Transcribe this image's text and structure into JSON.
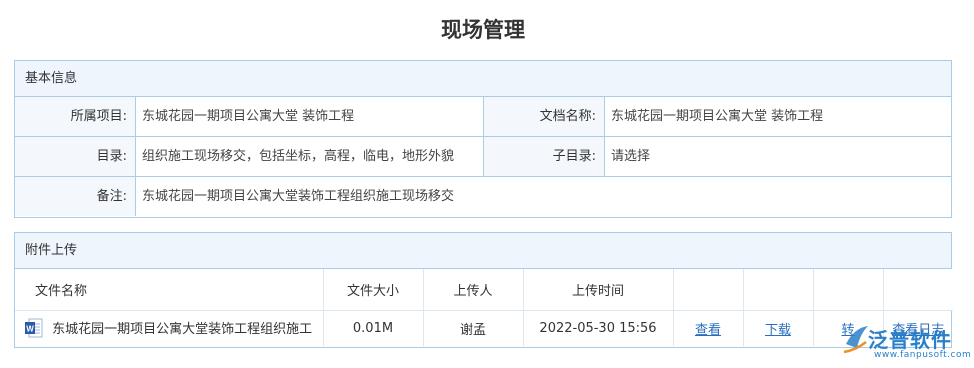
{
  "page": {
    "title": "现场管理"
  },
  "basic_info": {
    "header": "基本信息",
    "project_label": "所属项目:",
    "project_value": "东城花园一期项目公寓大堂 装饰工程",
    "doc_name_label": "文档名称:",
    "doc_name_value": "东城花园一期项目公寓大堂 装饰工程",
    "catalog_label": "目录:",
    "catalog_value": "组织施工现场移交，包括坐标，高程，临电，地形外貌",
    "subcatalog_label": "子目录:",
    "subcatalog_value": "请选择",
    "remark_label": "备注:",
    "remark_value": "东城花园一期项目公寓大堂装饰工程组织施工现场移交"
  },
  "attachments": {
    "header": "附件上传",
    "columns": [
      "文件名称",
      "文件大小",
      "上传人",
      "上传时间",
      "",
      "",
      "",
      ""
    ],
    "rows": [
      {
        "icon": "word-doc-icon",
        "file_name": "东城花园一期项目公寓大堂装饰工程组织施工",
        "size": "0.01M",
        "uploader": "谢孟",
        "time": "2022-05-30 15:56",
        "view": "查看",
        "download": "下载",
        "convert": "转",
        "view_log": "查看日志"
      }
    ]
  },
  "watermark": {
    "brand": "泛普软件",
    "url": "www.fanpusoft.com",
    "color": "#2a7fc8"
  }
}
